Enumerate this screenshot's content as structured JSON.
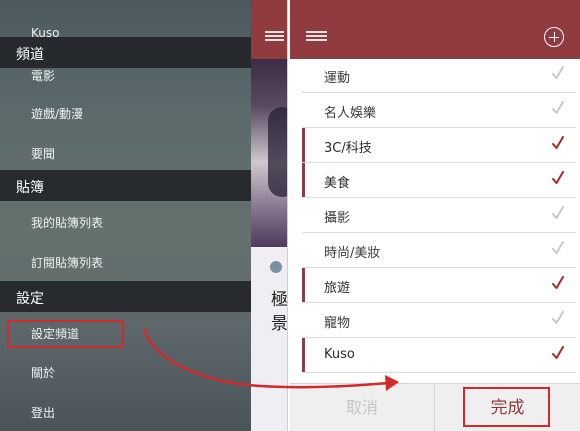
{
  "left_screen": {
    "drawer": {
      "top_item": "Kuso",
      "sections": [
        {
          "header": "頻道",
          "items": [
            "電影",
            "遊戲/動漫",
            "要聞"
          ]
        },
        {
          "header": "貼簿",
          "items": [
            "我的貼簿列表",
            "訂閱貼簿列表"
          ]
        },
        {
          "header": "設定",
          "items": [
            "設定頻道",
            "關於",
            "登出"
          ]
        }
      ]
    },
    "peek": {
      "text_line1": "極",
      "text_line2": "景"
    }
  },
  "right_screen": {
    "channels": [
      {
        "name": "運動",
        "selected": false
      },
      {
        "name": "名人娛樂",
        "selected": false
      },
      {
        "name": "3C/科技",
        "selected": true
      },
      {
        "name": "美食",
        "selected": true
      },
      {
        "name": "攝影",
        "selected": false
      },
      {
        "name": "時尚/美妝",
        "selected": false
      },
      {
        "name": "旅遊",
        "selected": true
      },
      {
        "name": "寵物",
        "selected": false
      },
      {
        "name": "Kuso",
        "selected": true
      }
    ],
    "cancel_label": "取消",
    "done_label": "完成"
  },
  "colors": {
    "brand": "#8f3b3f",
    "check_selected": "#a8282c",
    "check_unselected": "#c8c8c8",
    "annotation": "#d4292a"
  },
  "icons": {
    "menu": "hamburger-icon",
    "add": "plus-circle-icon",
    "check": "checkmark-icon"
  }
}
